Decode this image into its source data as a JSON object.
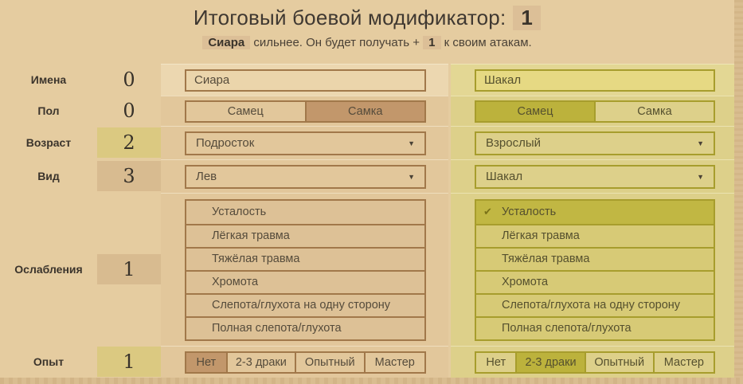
{
  "header": {
    "title": "Итоговый боевой модификатор:",
    "modifier_value": "1",
    "subtitle_name": "Сиара",
    "subtitle_text_1": "сильнее. Он будет получать +",
    "subtitle_bonus": "1",
    "subtitle_text_2": "к своим атакам."
  },
  "criteria": [
    {
      "label": "Имена",
      "value": "0",
      "advantage": "none"
    },
    {
      "label": "Пол",
      "value": "0",
      "advantage": "none"
    },
    {
      "label": "Возраст",
      "value": "2",
      "advantage": "right"
    },
    {
      "label": "Вид",
      "value": "3",
      "advantage": "left"
    },
    {
      "label": "Ослабления",
      "value": "1",
      "advantage": "left"
    },
    {
      "label": "Опыт",
      "value": "1",
      "advantage": "right"
    }
  ],
  "gender_options": [
    "Самец",
    "Самка"
  ],
  "experience_options": [
    "Нет",
    "2-3 драки",
    "Опытный",
    "Мастер"
  ],
  "debuff_options": [
    "Усталость",
    "Лёгкая травма",
    "Тяжёлая травма",
    "Хромота",
    "Слепота/глухота на одну сторону",
    "Полная слепота/глухота"
  ],
  "characters": {
    "left": {
      "name": "Сиара",
      "gender_selected": "Самка",
      "age": "Подросток",
      "species": "Лев",
      "debuffs_checked": [],
      "experience_selected": "Нет",
      "accent_color": "#c2976b",
      "border_color": "#a1784a"
    },
    "right": {
      "name": "Шакал",
      "gender_selected": "Самец",
      "age": "Взрослый",
      "species": "Шакал",
      "debuffs_checked": [
        "Усталость"
      ],
      "experience_selected": "2-3 драки",
      "accent_color": "#bcb23c",
      "border_color": "#a79d2d"
    }
  },
  "colors": {
    "page_bg": "#e5cca0",
    "badge_bg": "#dcbf97",
    "score_left_bg": "#d8bb90",
    "score_right_bg": "#dbc981",
    "check_color": "#7a7218"
  }
}
